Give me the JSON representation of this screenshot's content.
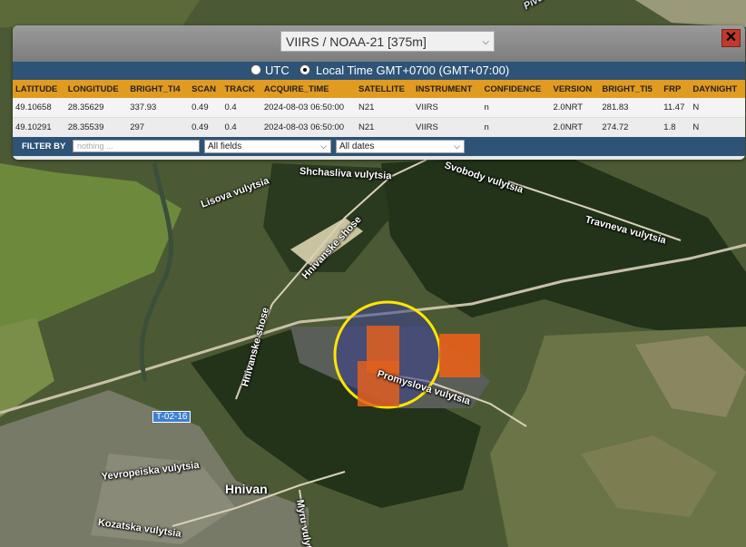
{
  "panel": {
    "satellite_select": "VIIRS / NOAA-21 [375m]",
    "time_options": {
      "utc": "UTC",
      "local": "Local Time GMT+0700 (GMT+07:00)",
      "selected": "local"
    },
    "close_label": "✕"
  },
  "table": {
    "headers": [
      "LATITUDE",
      "LONGITUDE",
      "BRIGHT_TI4",
      "SCAN",
      "TRACK",
      "ACQUIRE_TIME",
      "SATELLITE",
      "INSTRUMENT",
      "CONFIDENCE",
      "VERSION",
      "BRIGHT_TI5",
      "FRP",
      "DAYNIGHT"
    ],
    "rows": [
      [
        "49.10658",
        "28.35629",
        "337.93",
        "0.49",
        "0.4",
        "2024-08-03 06:50:00",
        "N21",
        "VIIRS",
        "n",
        "2.0NRT",
        "281.83",
        "11.47",
        "N"
      ],
      [
        "49.10291",
        "28.35539",
        "297",
        "0.49",
        "0.4",
        "2024-08-03 06:50:00",
        "N21",
        "VIIRS",
        "n",
        "2.0NRT",
        "274.72",
        "1.8",
        "N"
      ]
    ]
  },
  "filter": {
    "label": "FILTER BY",
    "input_placeholder": "nothing ...",
    "fields_select": "All fields",
    "dates_select": "All dates"
  },
  "map": {
    "labels": {
      "shchasliva": "Shchasliva vulytsia",
      "svobody": "Svobody vulytsia",
      "lisova": "Lisova vulytsia",
      "travneva": "Travneva vulytsia",
      "hnivanske_shose_1": "Hnivanske shose",
      "hnivanske_shose_2": "Hnivanske shose",
      "promyslova": "Promyslova vulytsia",
      "yevropeiska": "Yevropeiska vulytsia",
      "hnivan": "Hnivan",
      "myru": "Myru vulyts",
      "kozatska": "Kozatska vulytsia",
      "pivd": "Pivd",
      "shield": "T-02-16"
    },
    "colors": {
      "fire_marker": "#e2601c",
      "highlight_ring": "#ffe600",
      "highlight_fill": "#3a3f8f"
    }
  }
}
